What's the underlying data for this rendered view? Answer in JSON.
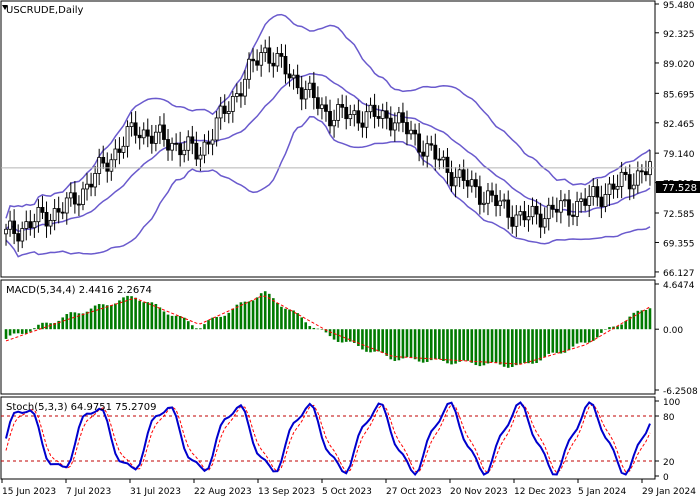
{
  "chart_data": [
    {
      "type": "candlestick",
      "title": "USCRUDE,Daily",
      "symbol": "USCRUDE",
      "timeframe": "Daily",
      "ylim": [
        66.12,
        95.48
      ],
      "y_ticks": [
        "95.480",
        "92.325",
        "89.020",
        "85.695",
        "82.465",
        "79.140",
        "75.910",
        "72.585",
        "69.355",
        "66.127"
      ],
      "x_ticks": [
        "15 Jun 2023",
        "7 Jul 2023",
        "31 Jul 2023",
        "22 Aug 2023",
        "13 Sep 2023",
        "5 Oct 2023",
        "27 Oct 2023",
        "20 Nov 2023",
        "12 Dec 2023",
        "5 Jan 2024",
        "29 Jan 2024"
      ],
      "current_price": "77.528",
      "series": [
        {
          "name": "close",
          "x": [
            "15 Jun 2023",
            "7 Jul 2023",
            "31 Jul 2023",
            "22 Aug 2023",
            "13 Sep 2023",
            "5 Oct 2023",
            "27 Oct 2023",
            "20 Nov 2023",
            "12 Dec 2023",
            "5 Jan 2024",
            "29 Jan 2024"
          ],
          "values": [
            70.2,
            73.5,
            81.8,
            79.1,
            90.6,
            83.4,
            83.1,
            76.5,
            71.9,
            73.8,
            77.5
          ]
        }
      ],
      "indicators": [
        "Bollinger Bands"
      ],
      "colors": {
        "candle": "#000000",
        "bollinger": "#6a5acd",
        "price_line": "#b4b4b4"
      }
    },
    {
      "type": "bar",
      "title": "MACD(5,34,4) 2.4416 2.2674",
      "y_ticks": [
        "4.6474",
        "0.00",
        "-6.2508"
      ],
      "ylim": [
        -6.2508,
        4.6474
      ],
      "series": [
        {
          "name": "MACD",
          "values": [
            -1.0,
            1.5,
            3.4,
            0.2,
            3.8,
            -0.7,
            -3.0,
            -3.4,
            -3.8,
            -1.4,
            2.4
          ]
        },
        {
          "name": "Signal",
          "values": [
            -1.2,
            1.1,
            3.2,
            0.5,
            3.5,
            -0.2,
            -2.8,
            -3.2,
            -3.6,
            -1.6,
            2.3
          ]
        }
      ],
      "colors": {
        "histogram": "#007a00",
        "signal": "#ff0000"
      }
    },
    {
      "type": "line",
      "title": "Stoch(5,3,3) 64.9751 75.2709",
      "y_ticks": [
        "100",
        "80",
        "20",
        "0"
      ],
      "ylim": [
        0,
        100
      ],
      "levels": [
        80,
        20
      ],
      "series": [
        {
          "name": "%K",
          "values": [
            70,
            85,
            92,
            30,
            90,
            15,
            30,
            60,
            10,
            55,
            65
          ]
        },
        {
          "name": "%D",
          "values": [
            65,
            80,
            88,
            40,
            85,
            20,
            35,
            55,
            15,
            50,
            75
          ]
        }
      ],
      "colors": {
        "k": "#0000cd",
        "d": "#ff0000",
        "levels": "#c00000"
      }
    }
  ]
}
